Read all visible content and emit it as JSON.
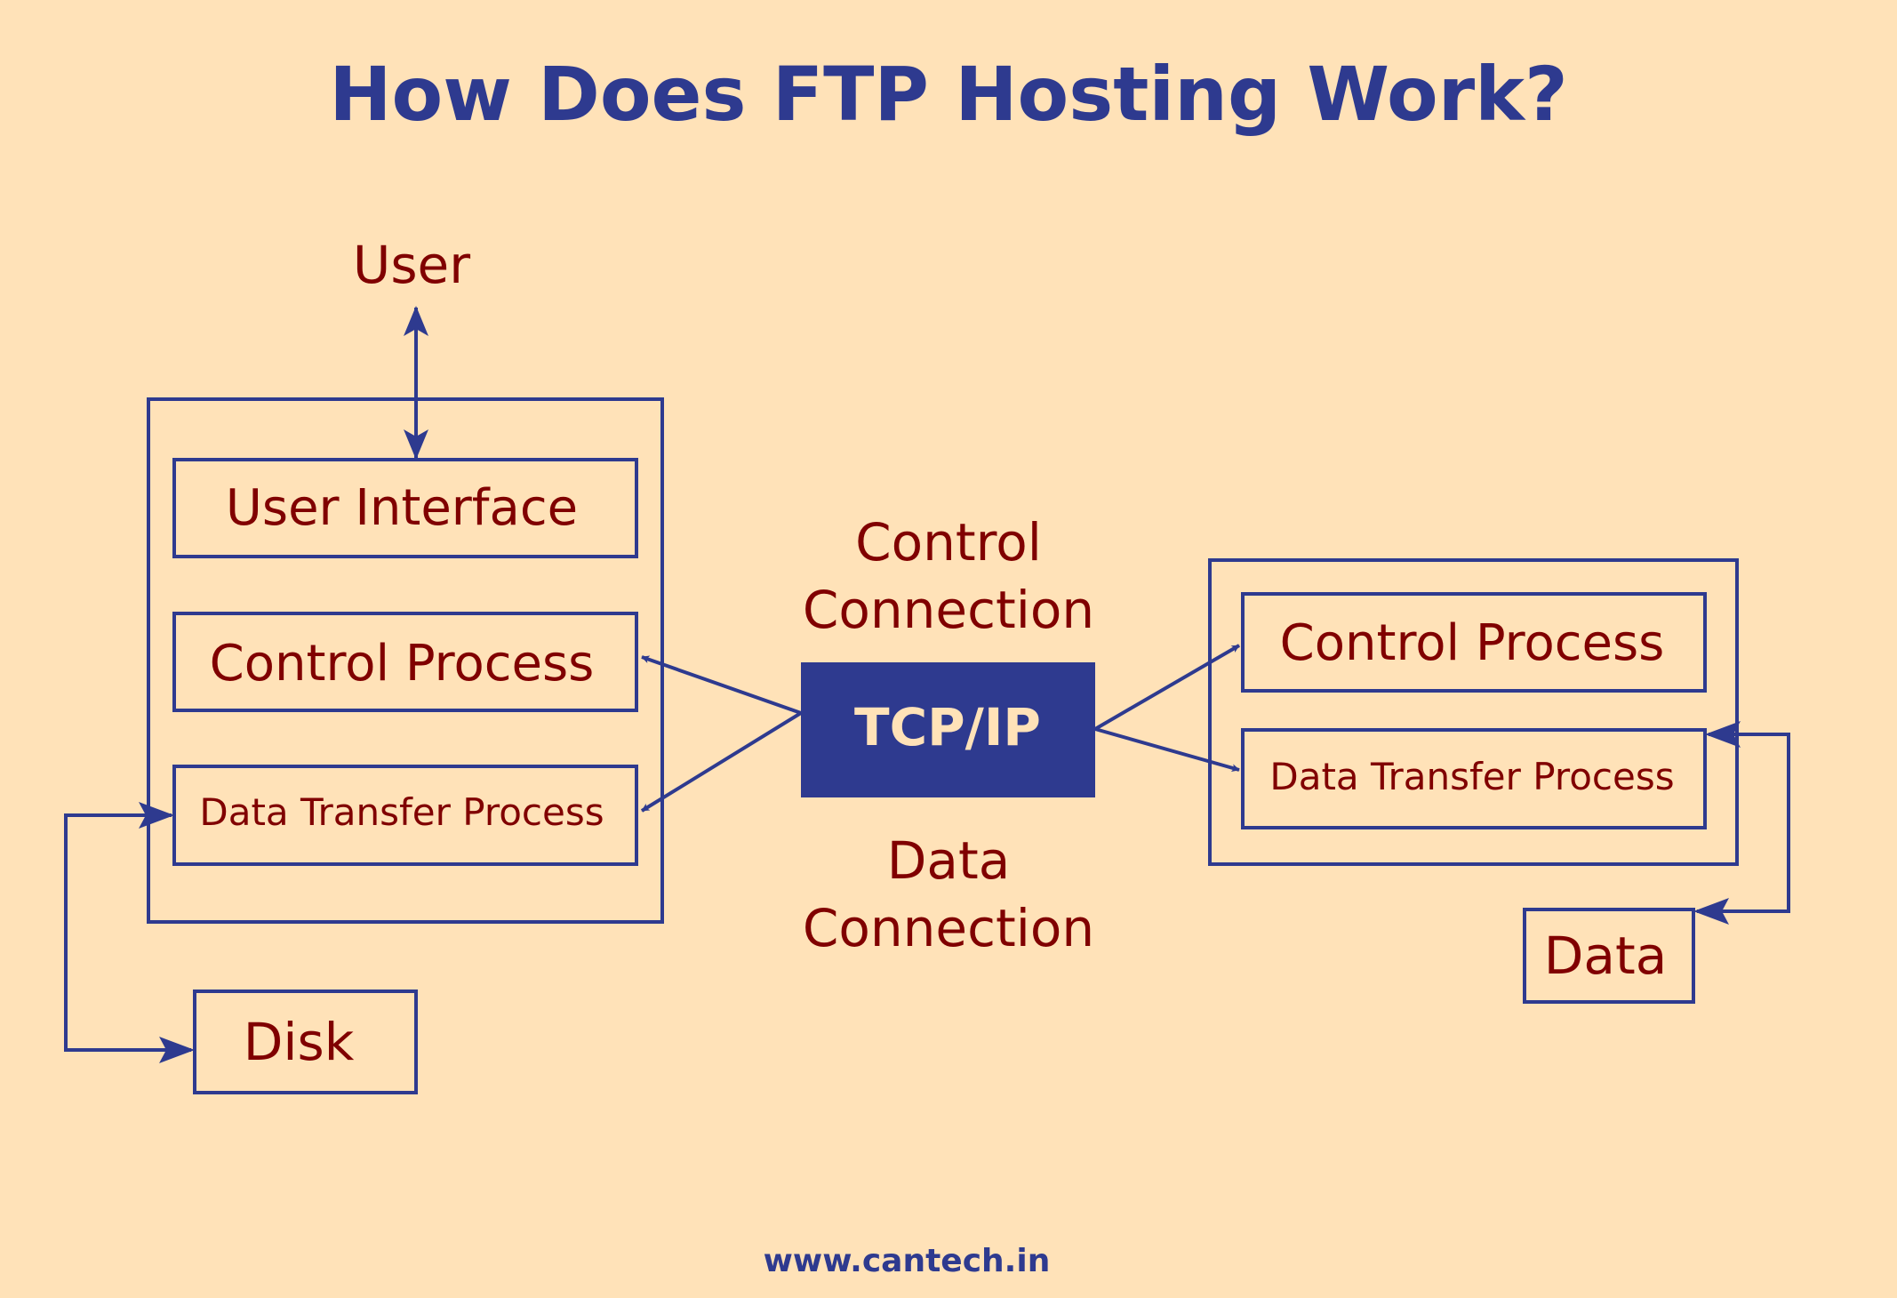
{
  "title": "How Does FTP Hosting Work?",
  "colors": {
    "background": "#ffe2b8",
    "accent_blue": "#2e3a8f",
    "label_red": "#800000"
  },
  "client": {
    "user_label": "User",
    "user_interface": "User Interface",
    "control_process": "Control Process",
    "data_transfer_process": "Data Transfer Process",
    "disk": "Disk"
  },
  "network": {
    "protocol": "TCP/IP",
    "control_connection": [
      "Control",
      "Connection"
    ],
    "data_connection": [
      "Data",
      "Connection"
    ]
  },
  "server": {
    "control_process": "Control Process",
    "data_transfer_process": "Data Transfer Process",
    "data": "Data"
  },
  "footer": "www.cantech.in"
}
